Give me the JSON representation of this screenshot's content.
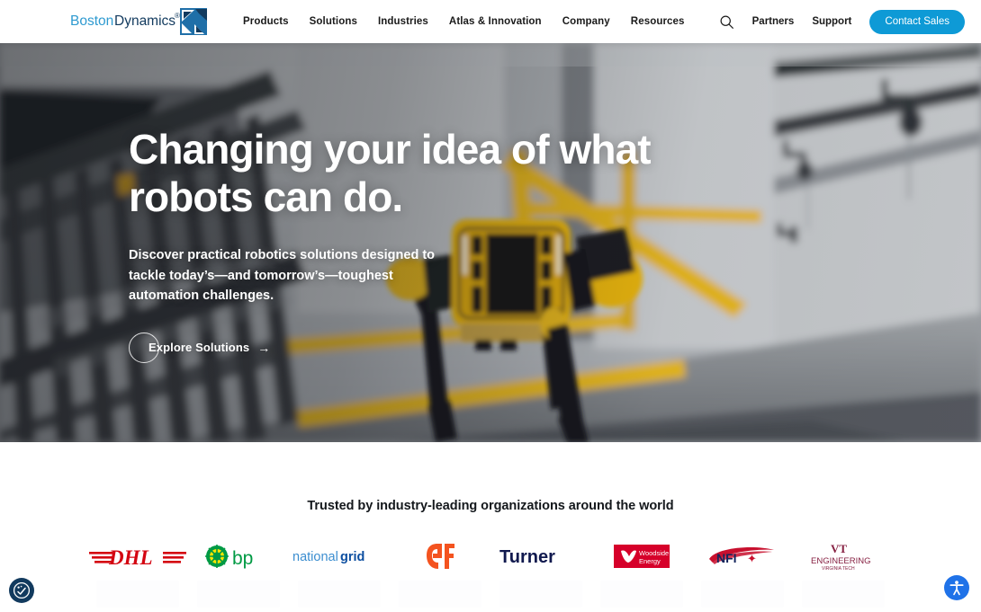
{
  "brand": {
    "name_part1": "Boston",
    "name_part2": "Dynamics",
    "trademark": "®",
    "logo_icon": "boston-dynamics-arrow-mark",
    "color_light": "#2e9ad0",
    "color_dark": "#123a5e"
  },
  "header": {
    "nav": [
      {
        "label": "Products"
      },
      {
        "label": "Solutions"
      },
      {
        "label": "Industries"
      },
      {
        "label": "Atlas & Innovation"
      },
      {
        "label": "Company"
      },
      {
        "label": "Resources"
      }
    ],
    "search_icon": "search-icon",
    "utility": [
      {
        "label": "Partners"
      },
      {
        "label": "Support"
      }
    ],
    "contact_button": "Contact Sales",
    "contact_button_color": "#0e9ad6"
  },
  "hero": {
    "title_line1": "Changing your idea of what",
    "title_line2": "robots can do.",
    "subtitle": "Discover practical robotics solutions designed to tackle today’s—and tomorrow’s—toughest automation challenges.",
    "cta_label": "Explore Solutions",
    "cta_arrow": "→",
    "background_scene": "blurred industrial stairwell with yellow Spot quadruped robot"
  },
  "trusted": {
    "title": "Trusted by industry-leading organizations around the world",
    "logos": [
      {
        "name": "DHL",
        "icon": "dhl-logo",
        "color": "#d40511"
      },
      {
        "name": "bp",
        "icon": "bp-logo",
        "color": "#009a44"
      },
      {
        "name": "nationalgrid",
        "icon": "national-grid-logo",
        "color": "#0075c9"
      },
      {
        "name": "GF",
        "icon": "georg-fischer-logo",
        "color": "#f4531f"
      },
      {
        "name": "Turner",
        "icon": "turner-logo",
        "color": "#10194e"
      },
      {
        "name": "Woodside Energy",
        "icon": "woodside-energy-logo",
        "color": "#d6002a"
      },
      {
        "name": "NFI",
        "icon": "nfi-logo",
        "color": "#13255c"
      },
      {
        "name": "VT Engineering Virginia Tech",
        "icon": "virginia-tech-engineering-logo",
        "color": "#861f41"
      }
    ]
  },
  "widgets": {
    "privacy_icon": "privacy-options-icon",
    "accessibility_icon": "accessibility-person-icon"
  }
}
